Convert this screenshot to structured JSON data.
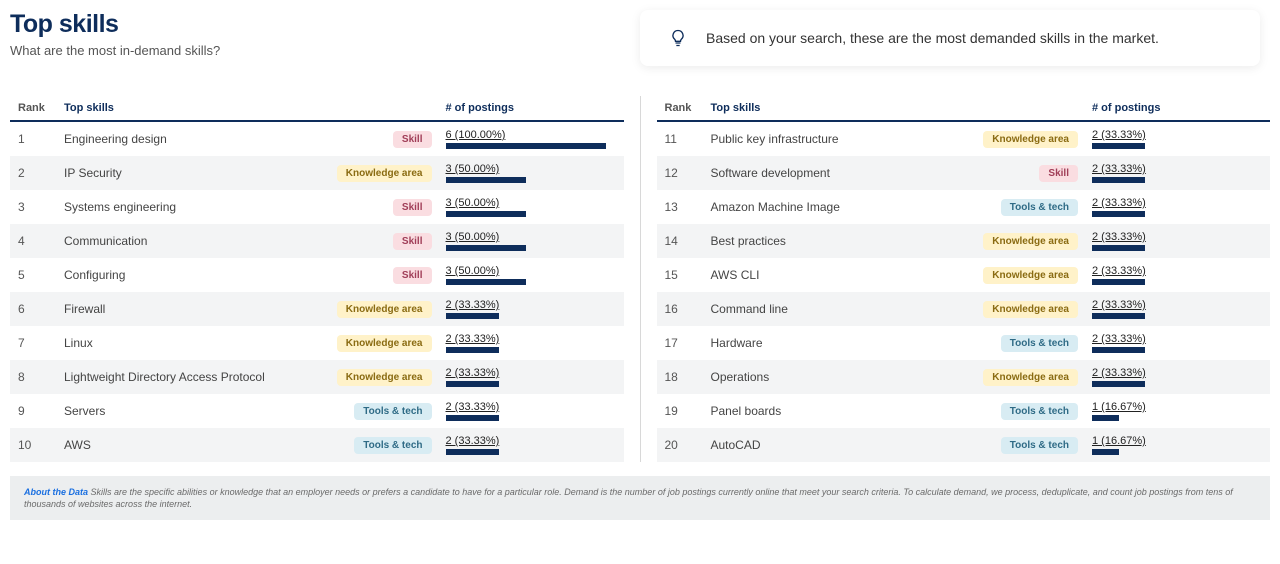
{
  "header": {
    "title": "Top skills",
    "subtitle": "What are the most in-demand skills?",
    "info_message": "Based on your search, these are the most demanded skills in the market."
  },
  "columns": {
    "rank": "Rank",
    "skill": "Top skills",
    "postings": "# of postings"
  },
  "tags": {
    "skill": "Skill",
    "knowledge": "Knowledge area",
    "tools": "Tools & tech"
  },
  "left": [
    {
      "rank": "1",
      "name": "Engineering design",
      "tag": "skill",
      "label": "6 (100.00%)",
      "pct": 100
    },
    {
      "rank": "2",
      "name": "IP Security",
      "tag": "knowledge",
      "label": "3 (50.00%)",
      "pct": 50
    },
    {
      "rank": "3",
      "name": "Systems engineering",
      "tag": "skill",
      "label": "3 (50.00%)",
      "pct": 50
    },
    {
      "rank": "4",
      "name": "Communication",
      "tag": "skill",
      "label": "3 (50.00%)",
      "pct": 50
    },
    {
      "rank": "5",
      "name": "Configuring",
      "tag": "skill",
      "label": "3 (50.00%)",
      "pct": 50
    },
    {
      "rank": "6",
      "name": "Firewall",
      "tag": "knowledge",
      "label": "2 (33.33%)",
      "pct": 33.33
    },
    {
      "rank": "7",
      "name": "Linux",
      "tag": "knowledge",
      "label": "2 (33.33%)",
      "pct": 33.33
    },
    {
      "rank": "8",
      "name": "Lightweight Directory Access Protocol",
      "tag": "knowledge",
      "label": "2 (33.33%)",
      "pct": 33.33
    },
    {
      "rank": "9",
      "name": "Servers",
      "tag": "tools",
      "label": "2 (33.33%)",
      "pct": 33.33
    },
    {
      "rank": "10",
      "name": "AWS",
      "tag": "tools",
      "label": "2 (33.33%)",
      "pct": 33.33
    }
  ],
  "right": [
    {
      "rank": "11",
      "name": "Public key infrastructure",
      "tag": "knowledge",
      "label": "2 (33.33%)",
      "pct": 33.33
    },
    {
      "rank": "12",
      "name": "Software development",
      "tag": "skill",
      "label": "2 (33.33%)",
      "pct": 33.33
    },
    {
      "rank": "13",
      "name": "Amazon Machine Image",
      "tag": "tools",
      "label": "2 (33.33%)",
      "pct": 33.33
    },
    {
      "rank": "14",
      "name": "Best practices",
      "tag": "knowledge",
      "label": "2 (33.33%)",
      "pct": 33.33
    },
    {
      "rank": "15",
      "name": "AWS CLI",
      "tag": "knowledge",
      "label": "2 (33.33%)",
      "pct": 33.33
    },
    {
      "rank": "16",
      "name": "Command line",
      "tag": "knowledge",
      "label": "2 (33.33%)",
      "pct": 33.33
    },
    {
      "rank": "17",
      "name": "Hardware",
      "tag": "tools",
      "label": "2 (33.33%)",
      "pct": 33.33
    },
    {
      "rank": "18",
      "name": "Operations",
      "tag": "knowledge",
      "label": "2 (33.33%)",
      "pct": 33.33
    },
    {
      "rank": "19",
      "name": "Panel boards",
      "tag": "tools",
      "label": "1 (16.67%)",
      "pct": 16.67
    },
    {
      "rank": "20",
      "name": "AutoCAD",
      "tag": "tools",
      "label": "1 (16.67%)",
      "pct": 16.67
    }
  ],
  "footer": {
    "about_label": "About the Data",
    "text": "Skills are the specific abilities or knowledge that an employer needs or prefers a candidate to have for a particular role. Demand is the number of job postings currently online that meet your search criteria. To calculate demand, we process, deduplicate, and count job postings from tens of thousands of websites across the internet."
  },
  "chart_data": {
    "type": "bar",
    "title": "Top skills — # of postings",
    "xlabel": "# of postings",
    "ylabel": "Skill",
    "categories": [
      "Engineering design",
      "IP Security",
      "Systems engineering",
      "Communication",
      "Configuring",
      "Firewall",
      "Linux",
      "Lightweight Directory Access Protocol",
      "Servers",
      "AWS",
      "Public key infrastructure",
      "Software development",
      "Amazon Machine Image",
      "Best practices",
      "AWS CLI",
      "Command line",
      "Hardware",
      "Operations",
      "Panel boards",
      "AutoCAD"
    ],
    "values": [
      6,
      3,
      3,
      3,
      3,
      2,
      2,
      2,
      2,
      2,
      2,
      2,
      2,
      2,
      2,
      2,
      2,
      2,
      1,
      1
    ],
    "percent": [
      100,
      50,
      50,
      50,
      50,
      33.33,
      33.33,
      33.33,
      33.33,
      33.33,
      33.33,
      33.33,
      33.33,
      33.33,
      33.33,
      33.33,
      33.33,
      33.33,
      16.67,
      16.67
    ],
    "xlim": [
      0,
      6
    ]
  }
}
